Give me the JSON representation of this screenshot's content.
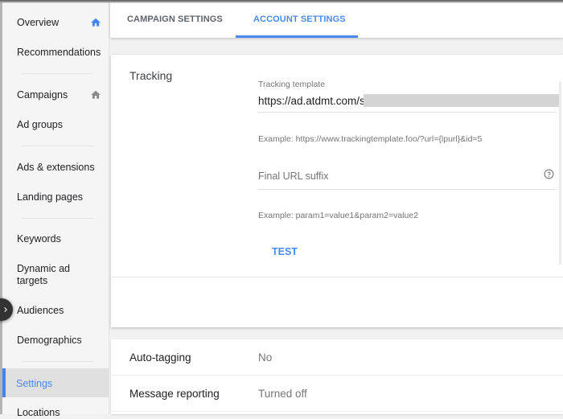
{
  "sidebar": {
    "items": [
      {
        "label": "Overview",
        "icon": "home-icon",
        "icon_color": "#4285f4"
      },
      {
        "label": "Recommendations"
      },
      {
        "label": "Campaigns",
        "icon": "home-icon",
        "icon_color": "#757575"
      },
      {
        "label": "Ad groups"
      },
      {
        "label": "Ads & extensions"
      },
      {
        "label": "Landing pages"
      },
      {
        "label": "Keywords"
      },
      {
        "label": "Dynamic ad targets"
      },
      {
        "label": "Audiences"
      },
      {
        "label": "Demographics"
      },
      {
        "label": "Settings",
        "active": true
      },
      {
        "label": "Locations"
      }
    ],
    "expand_icon": "chevron-right-icon"
  },
  "tabs": [
    {
      "label": "CAMPAIGN SETTINGS",
      "active": false
    },
    {
      "label": "ACCOUNT SETTINGS",
      "active": true
    }
  ],
  "tracking": {
    "title": "Tracking",
    "template_label": "Tracking template",
    "template_value": "https://ad.atdmt.com/s",
    "template_example": "Example: https://www.trackingtemplate.foo/?url={lpurl}&id=5",
    "suffix_placeholder": "Final URL suffix",
    "suffix_example": "Example: param1=value1&param2=value2",
    "help_icon": "help-circle-icon",
    "test_label": "TEST"
  },
  "settings_rows": [
    {
      "label": "Auto-tagging",
      "value": "No"
    },
    {
      "label": "Message reporting",
      "value": "Turned off"
    }
  ],
  "colors": {
    "accent": "#4a89f0",
    "active_bg": "#e0e0e0",
    "muted_text": "#757575"
  }
}
